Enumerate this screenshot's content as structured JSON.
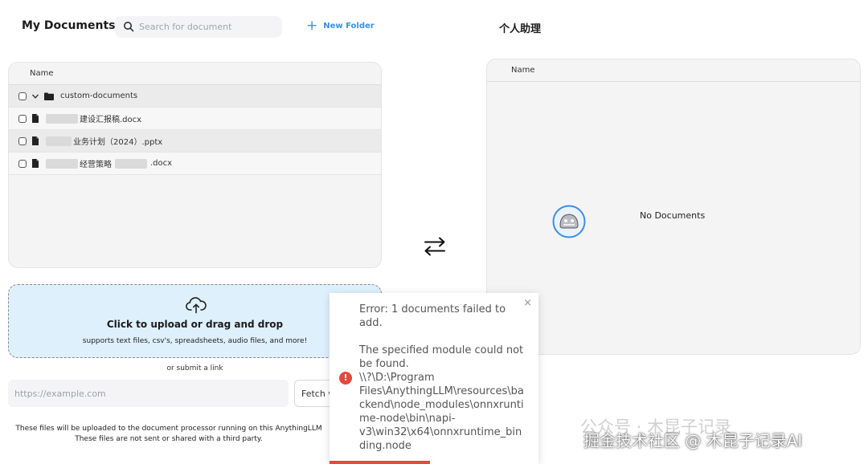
{
  "documents_panel": {
    "title": "My Documents",
    "search_placeholder": "Search for document",
    "new_folder_label": "New Folder",
    "column_name": "Name",
    "folder": {
      "name": "custom-documents"
    },
    "files": [
      {
        "name": "建设汇报稿.docx"
      },
      {
        "name": "业务计划（2024）.pptx"
      },
      {
        "name_part1": "经营策略",
        "name_part2": ".docx"
      }
    ]
  },
  "upload": {
    "title": "Click to upload or drag and drop",
    "subtitle": "supports text files, csv's, spreadsheets, audio files, and more!",
    "or_link": "or submit a link",
    "url_placeholder": "https://example.com",
    "fetch_label": "Fetch w",
    "footnote_line1": "These files will be uploaded to the document processor running on this AnythingLLM",
    "footnote_line2": "These files are not sent or shared with a third party."
  },
  "workspace_panel": {
    "title": "个人助理",
    "column_name": "Name",
    "empty_text": "No Documents"
  },
  "toast": {
    "close_label": "×",
    "icon_label": "!",
    "line1": "Error: 1 documents failed to add.",
    "line2": "The specified module could not be found.",
    "line3": "\\\\?\\D:\\Program Files\\AnythingLLM\\resources\\backend\\node_modules\\onnxruntime-node\\bin\\napi-v3\\win32\\x64\\onnxruntime_binding.node",
    "progress": 0.48,
    "color": "#e5483d"
  },
  "watermark": {
    "line1": "公众号 · 木昆子记录",
    "line2": "掘金技术社区 @ 木昆子记录AI"
  },
  "colors": {
    "accent": "#3b8ee8",
    "upload_bg": "#dff0fd",
    "error": "#e5483d"
  }
}
